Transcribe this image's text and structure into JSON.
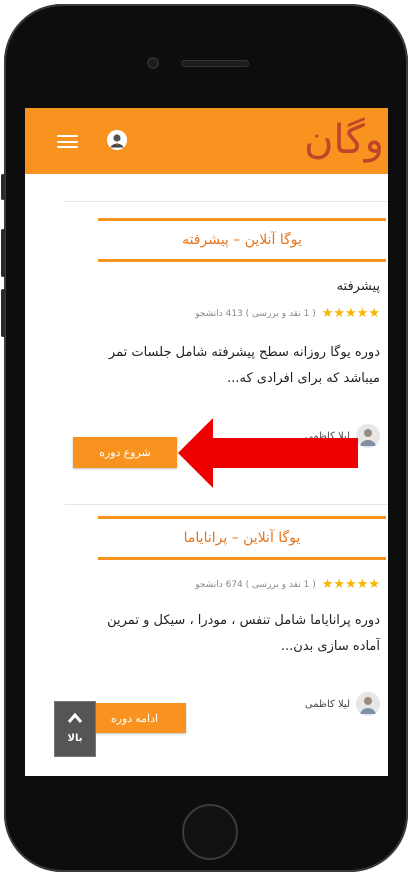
{
  "app": {
    "logo_text": "وگان",
    "brand_color": "#f7931e",
    "icons": [
      "menu-icon",
      "user-avatar-icon",
      "chevron-up-icon"
    ]
  },
  "courses": [
    {
      "title": "یوگا آنلاین – پیشرفته",
      "level": "پیشرفته",
      "rating_stars": 5,
      "rating_text": "( 1 نقد و بررسی ) 413 دانشجو",
      "desc_line1": "دوره یوگا روزانه سطح پیشرفته شامل جلسات تمر",
      "desc_line2": "میباشد که برای افرادی که...",
      "instructor": "لیلا کاظمی",
      "button_label": "شروع دوره"
    },
    {
      "title": "یوگا آنلاین – پرانایاما",
      "rating_stars": 5,
      "rating_text": "( 1 نقد و بررسی ) 674 دانشجو",
      "desc_line1": "دوره پرانایاما شامل تنفس ، مودرا ، سیکل و تمرین",
      "desc_line2": "آماده سازی بدن...",
      "instructor": "لیلا کاظمی",
      "button_label": "ادامه دوره"
    }
  ],
  "back_to_top": {
    "label": "بالا"
  },
  "annotation": {
    "arrow_color": "#ee0000"
  }
}
